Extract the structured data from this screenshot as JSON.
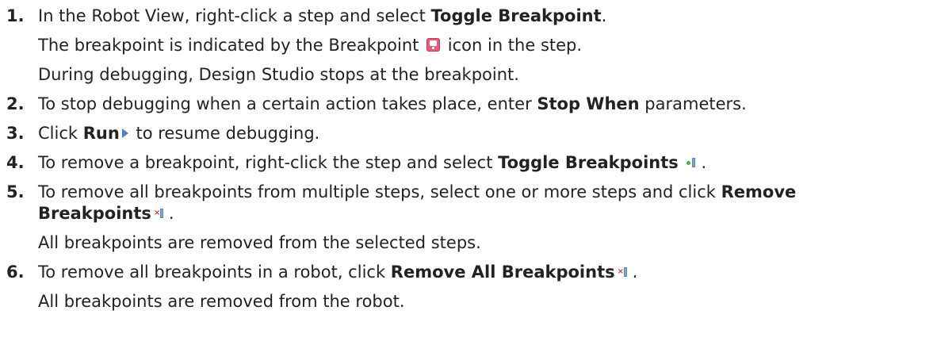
{
  "steps": [
    {
      "number": "1.",
      "pre": "In the Robot View, right-click a step and select ",
      "bold": "Toggle Breakpoint",
      "post": ".",
      "sub1_pre": "The breakpoint is indicated by the Breakpoint ",
      "sub1_post": " icon in the step.",
      "sub2": "During debugging, Design Studio stops at the breakpoint.",
      "icon": "breakpoint-icon"
    },
    {
      "number": "2.",
      "pre": "To stop debugging when a certain action takes place, enter ",
      "bold": "Stop When",
      "post": " parameters."
    },
    {
      "number": "3.",
      "pre": "Click ",
      "bold": "Run",
      "post": " to resume debugging.",
      "icon": "run-icon"
    },
    {
      "number": "4.",
      "pre": "To remove a breakpoint, right-click the step and select ",
      "bold": "Toggle Breakpoints",
      "post": ".",
      "icon": "toggle-breakpoints-icon"
    },
    {
      "number": "5.",
      "pre": "To remove all breakpoints from multiple steps, select one or more steps and click ",
      "bold1": "Remove",
      "bold2": "Breakpoints",
      "post": ".",
      "sub": "All breakpoints are removed from the selected steps.",
      "icon": "remove-breakpoints-icon"
    },
    {
      "number": "6.",
      "pre": "To remove all breakpoints in a robot, click ",
      "bold": "Remove All Breakpoints",
      "post": ".",
      "sub": "All breakpoints are removed from the robot.",
      "icon": "remove-all-breakpoints-icon"
    }
  ],
  "colors": {
    "text": "#222222",
    "breakpoint_icon": "#e55a7d",
    "run_icon": "#4a7fc1",
    "toggle_dot": "#4cae4c",
    "remove_x": "#d23b3b"
  }
}
